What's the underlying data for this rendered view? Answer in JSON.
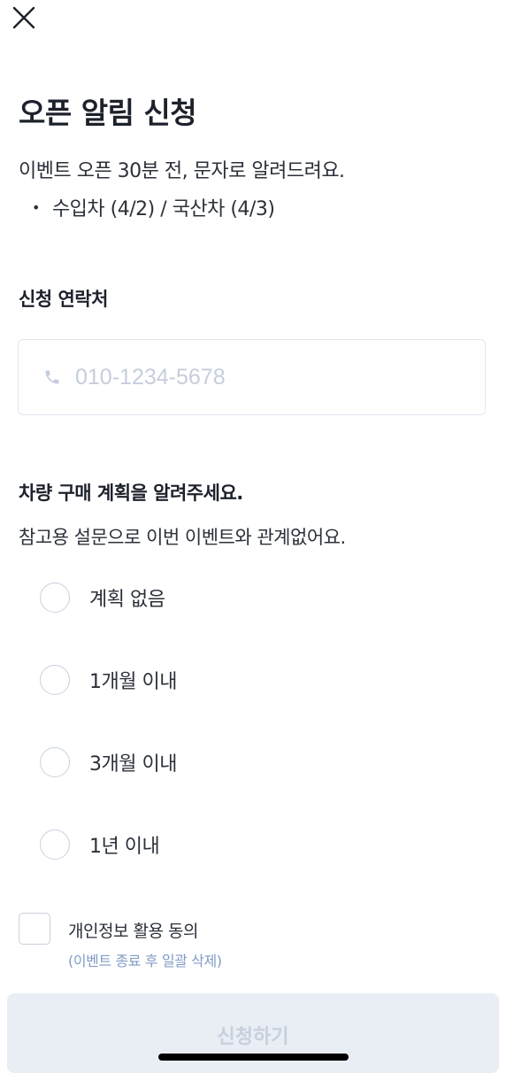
{
  "header": {
    "title": "오픈 알림 신청",
    "subtitle": "이벤트 오픈 30분 전, 문자로 알려드려요.",
    "bullet": "•",
    "bullet_text": "수입차 (4/2) / 국산차 (4/3)"
  },
  "contact": {
    "label": "신청 연락처",
    "placeholder": "010-1234-5678",
    "value": ""
  },
  "survey": {
    "title": "차량 구매 계획을 알려주세요.",
    "description": "참고용 설문으로 이번 이벤트와 관계없어요.",
    "options": [
      "계획 없음",
      "1개월 이내",
      "3개월 이내",
      "1년 이내"
    ],
    "selected": null
  },
  "consent": {
    "label": "개인정보 활용 동의",
    "note": "(이벤트 종료 후 일괄 삭제)",
    "checked": false
  },
  "submit": {
    "label": "신청하기",
    "enabled": false
  },
  "icons": {
    "close": "close-icon",
    "phone": "phone-icon"
  },
  "colors": {
    "title_text": "#1c212b",
    "body_text": "#2b303a",
    "placeholder": "#c5cedc",
    "border": "#c9d1de",
    "note_text": "#7f9bc4",
    "button_disabled_bg": "#e9edf4",
    "button_disabled_text": "#c8d0dd"
  }
}
